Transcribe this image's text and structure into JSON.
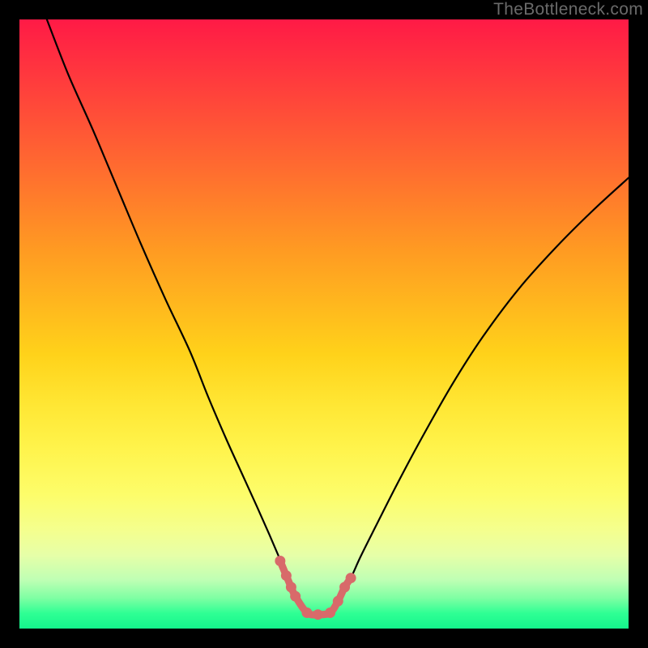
{
  "watermark": "TheBottleneck.com",
  "colors": {
    "curve_stroke": "#000000",
    "marker_stroke": "#d86a6a",
    "marker_fill": "#d86a6a",
    "gradient_top": "#ff1a46",
    "gradient_bottom": "#14f58c"
  },
  "chart_data": {
    "type": "line",
    "title": "",
    "xlabel": "",
    "ylabel": "",
    "xlim": [
      0,
      100
    ],
    "ylim": [
      0,
      100
    ],
    "grid": false,
    "legend": false,
    "series": [
      {
        "name": "bottleneck-curve",
        "x": [
          4.5,
          8,
          12,
          16,
          20,
          24,
          28,
          31,
          34,
          36.5,
          39,
          41,
          42.5,
          43.8,
          45,
          46,
          47,
          51,
          52,
          53,
          54.5,
          56,
          58.5,
          62,
          66,
          71,
          76,
          82,
          88,
          94,
          100
        ],
        "y": [
          100,
          91,
          82,
          72.5,
          63,
          54,
          45.5,
          38,
          31,
          25.5,
          20,
          15.5,
          12,
          9,
          6.4,
          4.2,
          2.5,
          2.5,
          3.8,
          5.7,
          8.5,
          11.8,
          16.8,
          23.7,
          31.2,
          40,
          47.8,
          55.8,
          62.5,
          68.5,
          74
        ]
      },
      {
        "name": "optimum-markers",
        "x": [
          42.8,
          43.8,
          44.6,
          45.3,
          47.2,
          49.0,
          51.0,
          52.3,
          53.4,
          54.4
        ],
        "y": [
          11.1,
          8.7,
          6.8,
          5.3,
          2.6,
          2.3,
          2.6,
          4.5,
          6.8,
          8.3
        ]
      }
    ]
  }
}
